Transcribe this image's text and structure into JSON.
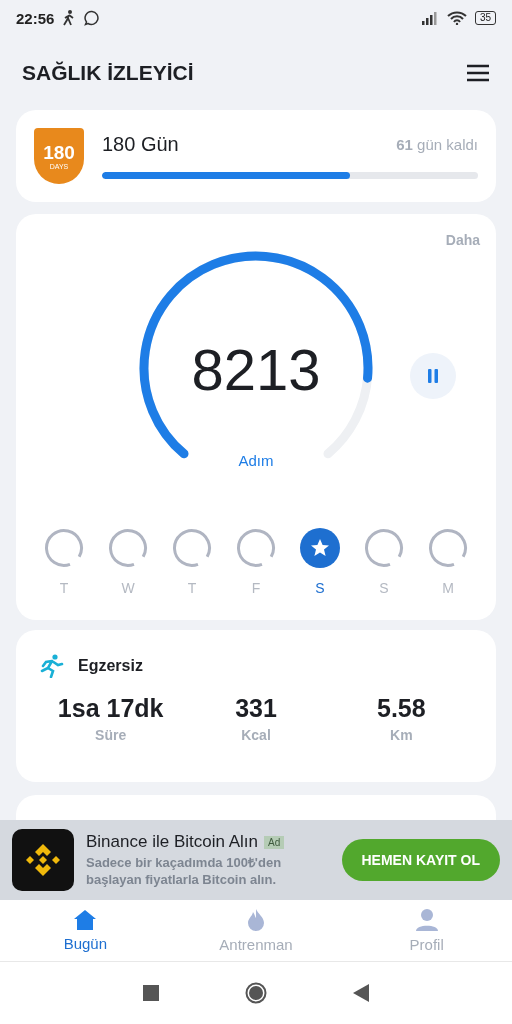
{
  "status_bar": {
    "time": "22:56",
    "battery": "35"
  },
  "header": {
    "title": "SAĞLIK İZLEYİCİ"
  },
  "goal": {
    "badge_number": "180",
    "badge_unit": "DAYS",
    "title": "180 Gün",
    "remaining_number": "61",
    "remaining_text": "gün kaldı",
    "level": 0.66
  },
  "steps": {
    "more": "Daha",
    "count": "8213",
    "label": "Adım",
    "paused": false
  },
  "days": [
    {
      "label": "T",
      "selected": false
    },
    {
      "label": "W",
      "selected": false
    },
    {
      "label": "T",
      "selected": false
    },
    {
      "label": "F",
      "selected": false
    },
    {
      "label": "S",
      "selected": true
    },
    {
      "label": "S",
      "selected": false
    },
    {
      "label": "M",
      "selected": false
    }
  ],
  "exercise": {
    "title": "Egzersiz",
    "stats": [
      {
        "value": "1sa 17dk",
        "label": "Süre"
      },
      {
        "value": "331",
        "label": "Kcal"
      },
      {
        "value": "5.58",
        "label": "Km"
      }
    ]
  },
  "ad": {
    "title": "Binance ile Bitcoin Alın",
    "badge": "Ad",
    "text": "Sadece bir kaçadımda 100₺'den başlayan fiyatlarla Bitcoin alın.",
    "button": "HEMEN KAYIT OL"
  },
  "tabs": [
    {
      "label": "Bugün",
      "selected": true
    },
    {
      "label": "Antrenman",
      "selected": false
    },
    {
      "label": "Profil",
      "selected": false
    }
  ]
}
